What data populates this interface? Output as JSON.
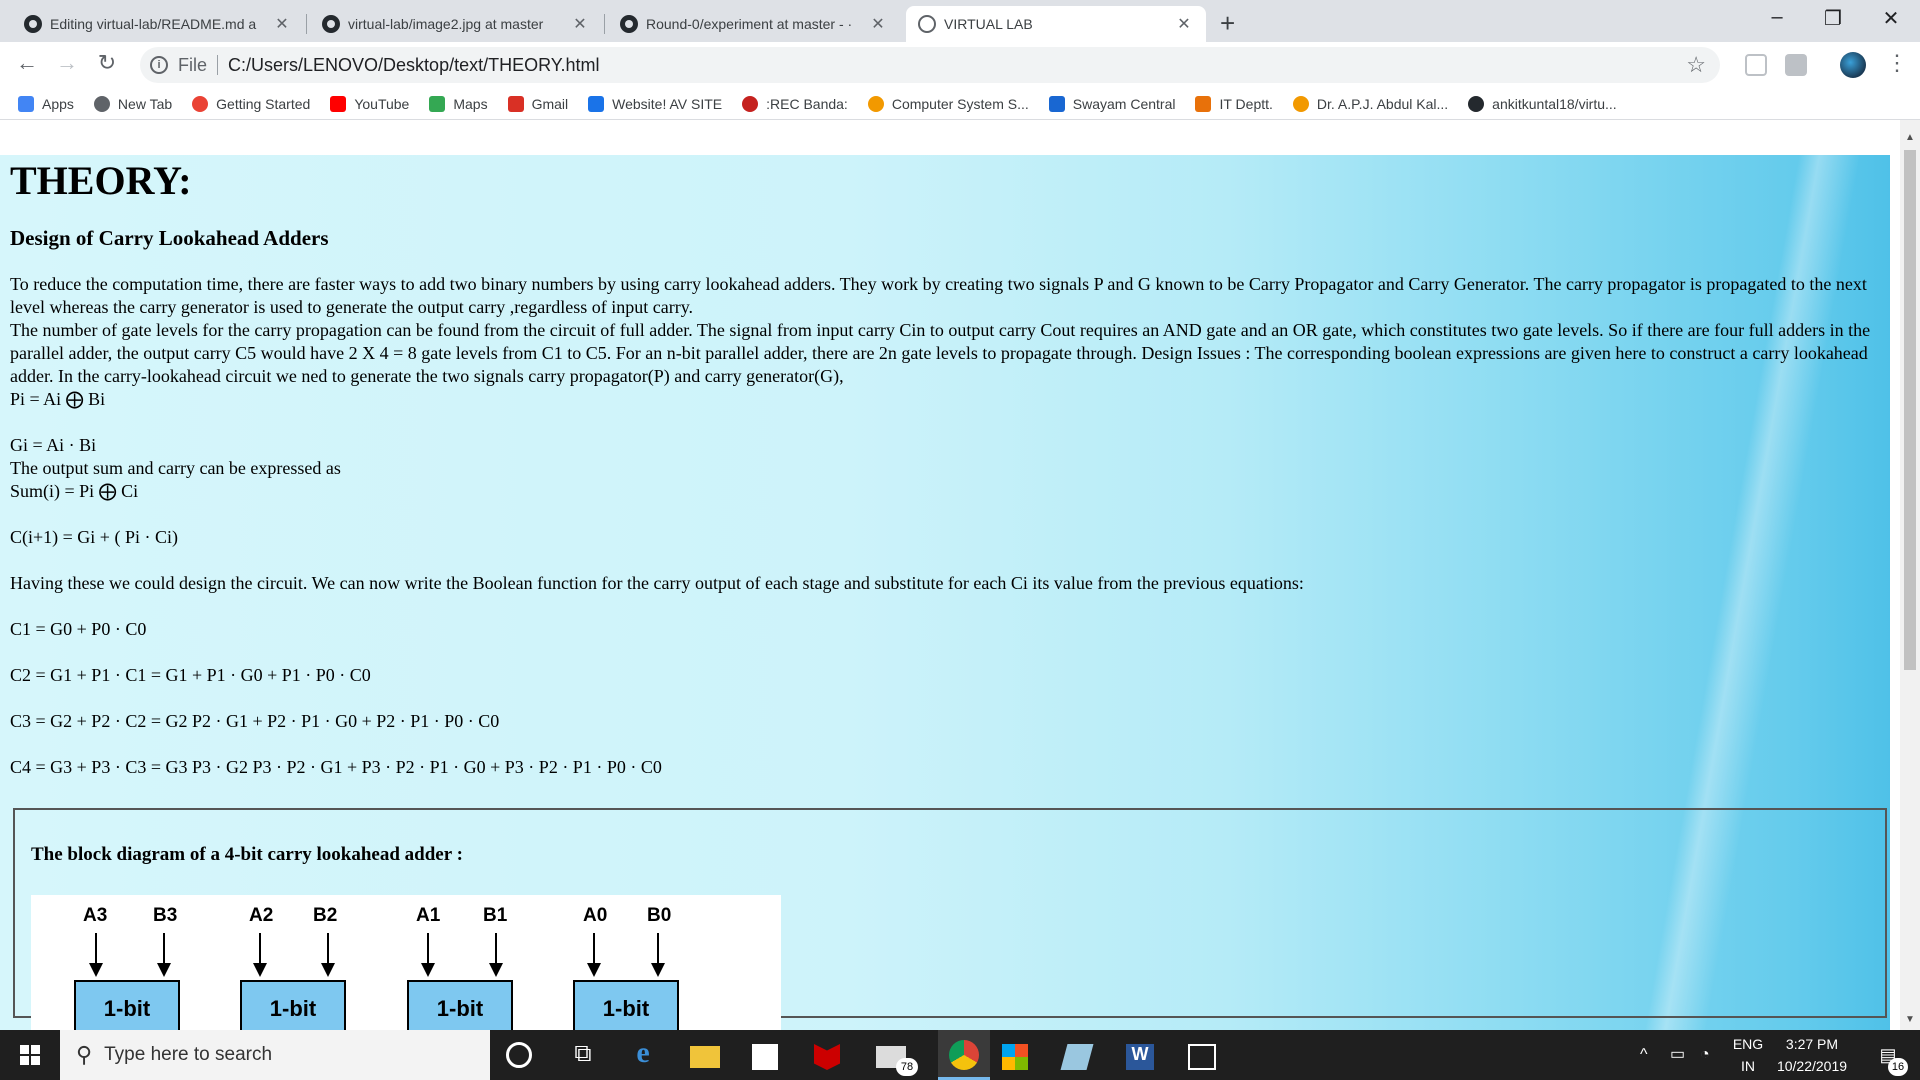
{
  "browser": {
    "tabs": [
      {
        "title": "Editing virtual-lab/README.md a",
        "icon": "github-icon",
        "active": false
      },
      {
        "title": "virtual-lab/image2.jpg at master",
        "icon": "github-icon",
        "active": false
      },
      {
        "title": "Round-0/experiment at master - ·",
        "icon": "github-icon",
        "active": false
      },
      {
        "title": "VIRTUAL LAB",
        "icon": "globe-icon",
        "active": true
      }
    ],
    "new_tab": "+",
    "window_controls": [
      "–",
      "❐",
      "✕"
    ],
    "address": {
      "file_label": "File",
      "url": "C:/Users/LENOVO/Desktop/text/THEORY.html"
    },
    "bookmarks": [
      {
        "label": "Apps",
        "color": "#4285f4"
      },
      {
        "label": "New Tab",
        "color": "#5f6368"
      },
      {
        "label": "Getting Started",
        "color": "#ea4335"
      },
      {
        "label": "YouTube",
        "color": "#ff0000"
      },
      {
        "label": "Maps",
        "color": "#34a853"
      },
      {
        "label": "Gmail",
        "color": "#d93025"
      },
      {
        "label": "Website! AV SITE",
        "color": "#1a73e8"
      },
      {
        "label": ":REC Banda:",
        "color": "#c5221f"
      },
      {
        "label": "Computer System S...",
        "color": "#f29900"
      },
      {
        "label": "Swayam Central",
        "color": "#1967d2"
      },
      {
        "label": "IT Deptt.",
        "color": "#e8710a"
      },
      {
        "label": "Dr. A.P.J. Abdul Kal...",
        "color": "#f29900"
      },
      {
        "label": "ankitkuntal18/virtu...",
        "color": "#24292e"
      }
    ]
  },
  "page": {
    "heading": "THEORY:",
    "subheading": "Design of Carry Lookahead Adders",
    "intro": "To reduce the computation time, there are faster ways to add two binary numbers by using carry lookahead adders. They work by creating two signals P and G known to be Carry Propagator and Carry Generator. The carry propagator is propagated to the next level whereas the carry generator is used to generate the output carry ,regardless of input carry.",
    "gate_levels": "The number of gate levels for the carry propagation can be found from the circuit of full adder. The signal from input carry Cin to output carry Cout requires an AND gate and an OR gate, which constitutes two gate levels. So if there are four full adders in the parallel adder, the output carry C5 would have 2 X 4 = 8 gate levels from C1 to C5. For an n-bit parallel adder, there are 2n gate levels to propagate through. Design Issues : The corresponding boolean expressions are given here to construct a carry lookahead adder. In the carry-lookahead circuit we ned to generate the two signals carry propagator(P) and carry generator(G),",
    "eq_p": "Pi = Ai ⨁ Bi",
    "eq_g": "Gi = Ai · Bi",
    "sum_carry_text": "The output sum and carry can be expressed as",
    "eq_sum": "Sum(i) = Pi ⨁ Ci",
    "eq_carry": "C(i+1) = Gi + ( Pi · Ci)",
    "boolean_text": "Having these we could design the circuit. We can now write the Boolean function for the carry output of each stage and substitute for each Ci its value from the previous equations:",
    "eq_c1": "C1 = G0 + P0 · C0",
    "eq_c2": "C2 = G1 + P1 · C1 = G1 + P1 · G0 + P1 · P0 · C0",
    "eq_c3": "C3 = G2 + P2 · C2 = G2 P2 · G1 + P2 · P1 · G0 + P2 · P1 · P0 · C0",
    "eq_c4": "C4 = G3 + P3 · C3 = G3 P3 · G2 P3 · P2 · G1 + P3 · P2 · P1 · G0 + P3 · P2 · P1 · P0 · C0",
    "diagram": {
      "title": "The block diagram of a 4-bit carry lookahead adder :",
      "inputs": [
        "A3",
        "B3",
        "A2",
        "B2",
        "A1",
        "B1",
        "A0",
        "B0"
      ],
      "block_label": "1-bit"
    }
  },
  "taskbar": {
    "search_placeholder": "Type here to search",
    "mail_badge": "78",
    "language": "ENG",
    "region": "IN",
    "time": "3:27 PM",
    "date": "10/22/2019",
    "notification_count": "16"
  }
}
